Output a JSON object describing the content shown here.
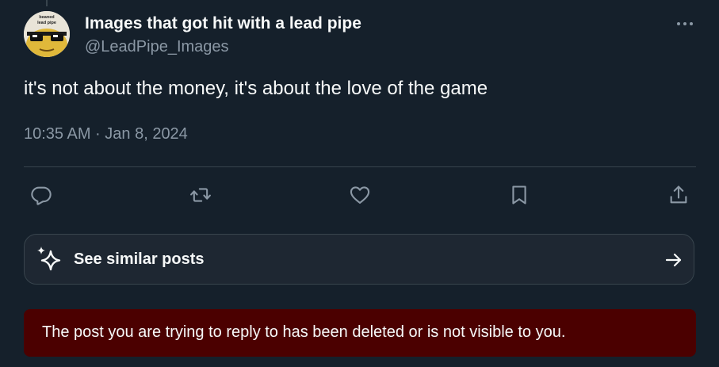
{
  "post": {
    "author_name": "Images that got hit with a lead pipe",
    "author_handle": "@LeadPipe_Images",
    "text": "it's not about the money, it's about the love of the game",
    "timestamp": "10:35 AM · Jan 8, 2024"
  },
  "avatar": {
    "caption_line_1": "beaned",
    "caption_line_2": "lead pipe"
  },
  "actions": [
    {
      "name": "reply",
      "icon": "reply-icon"
    },
    {
      "name": "repost",
      "icon": "repost-icon"
    },
    {
      "name": "like",
      "icon": "heart-icon"
    },
    {
      "name": "bookmark",
      "icon": "bookmark-icon"
    },
    {
      "name": "share",
      "icon": "share-icon"
    }
  ],
  "see_similar": {
    "label": "See similar posts",
    "icon": "sparkle-icon",
    "arrow_icon": "arrow-right-icon"
  },
  "notice": {
    "text": "The post you are trying to reply to has been deleted or is not visible to you."
  },
  "colors": {
    "background": "#15202b",
    "text_primary": "#f7f9f9",
    "text_secondary": "#8b98a5",
    "border": "#38444d",
    "notice_bg": "#4b0000"
  }
}
